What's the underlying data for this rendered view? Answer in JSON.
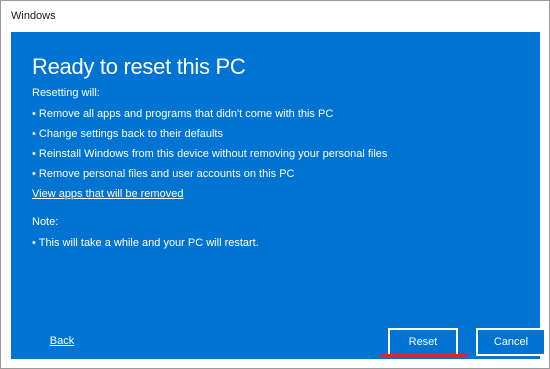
{
  "window": {
    "title": "Windows"
  },
  "panel": {
    "title": "Ready to reset this PC",
    "intro": "Resetting will:",
    "bullets": [
      "Remove all apps and programs that didn't come with this PC",
      "Change settings back to their defaults",
      "Reinstall Windows from this device without removing your personal files",
      "Remove personal files and user accounts on this PC"
    ],
    "link": "View apps that will be removed",
    "note_label": "Note:",
    "note_bullets": [
      "This will take a while and your PC will restart."
    ]
  },
  "footer": {
    "left_link": "Back",
    "primary_label": "Reset",
    "cancel_label": "Cancel"
  },
  "colors": {
    "panel_bg": "#0173d3",
    "accent_underline": "#e0242f"
  }
}
